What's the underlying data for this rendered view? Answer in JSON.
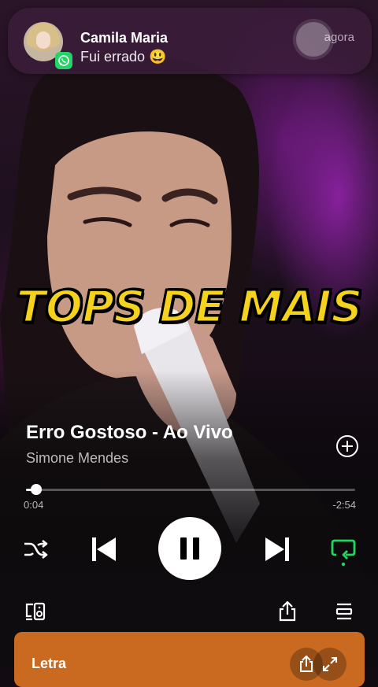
{
  "notification": {
    "sender": "Camila Maria",
    "message": "Fui errado 😃",
    "time": "agora",
    "app_icon": "whatsapp-icon"
  },
  "banner": {
    "text": "TOPS DE MAIS"
  },
  "track": {
    "title": "Erro Gostoso - Ao Vivo",
    "artist": "Simone Mendes"
  },
  "playback": {
    "elapsed": "0:04",
    "remaining": "-2:54",
    "progress_fraction": 0.03,
    "state": "playing"
  },
  "controls": {
    "shuffle_icon": "shuffle-icon",
    "previous_icon": "skip-previous-icon",
    "pause_icon": "pause-icon",
    "next_icon": "skip-next-icon",
    "repeat_icon": "repeat-icon",
    "repeat_color": "#1ed760"
  },
  "footer": {
    "devices_icon": "connect-device-icon",
    "share_icon": "share-icon",
    "queue_icon": "queue-icon"
  },
  "lyrics": {
    "label": "Letra",
    "background": "#c96a20"
  }
}
